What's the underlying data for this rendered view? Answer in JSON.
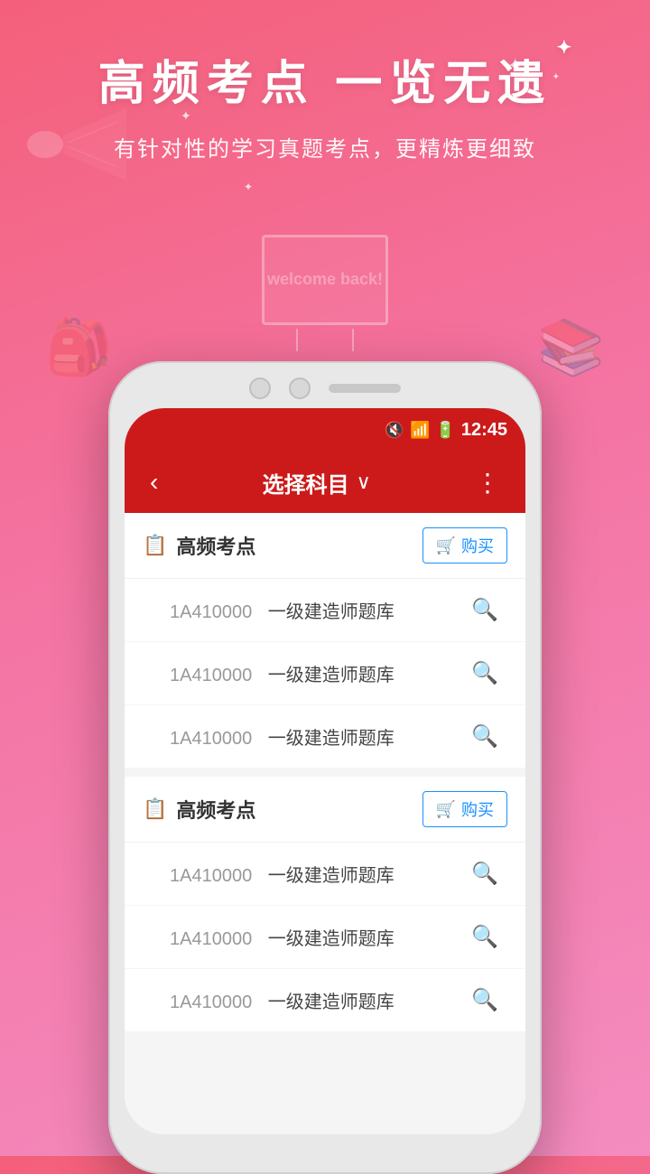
{
  "banner": {
    "title": "高频考点 一览无遗",
    "subtitle": "有针对性的学习真题考点，更精炼更细致",
    "welcome_text": "welcome back!"
  },
  "status_bar": {
    "time": "12:45",
    "icons": [
      "🔇",
      "📶",
      "🔋"
    ]
  },
  "header": {
    "back_label": "‹",
    "title": "选择科目",
    "chevron": "∨",
    "menu": "⋮"
  },
  "sections": [
    {
      "id": "section1",
      "title": "高频考点",
      "buy_label": "购买",
      "items": [
        {
          "code": "1A410000",
          "name": "一级建造师题库"
        },
        {
          "code": "1A410000",
          "name": "一级建造师题库"
        },
        {
          "code": "1A410000",
          "name": "一级建造师题库"
        }
      ]
    },
    {
      "id": "section2",
      "title": "高频考点",
      "buy_label": "购买",
      "items": [
        {
          "code": "1A410000",
          "name": "一级建造师题库"
        },
        {
          "code": "1A410000",
          "name": "一级建造师题库"
        },
        {
          "code": "1A410000",
          "name": "一级建造师题库"
        }
      ]
    }
  ]
}
